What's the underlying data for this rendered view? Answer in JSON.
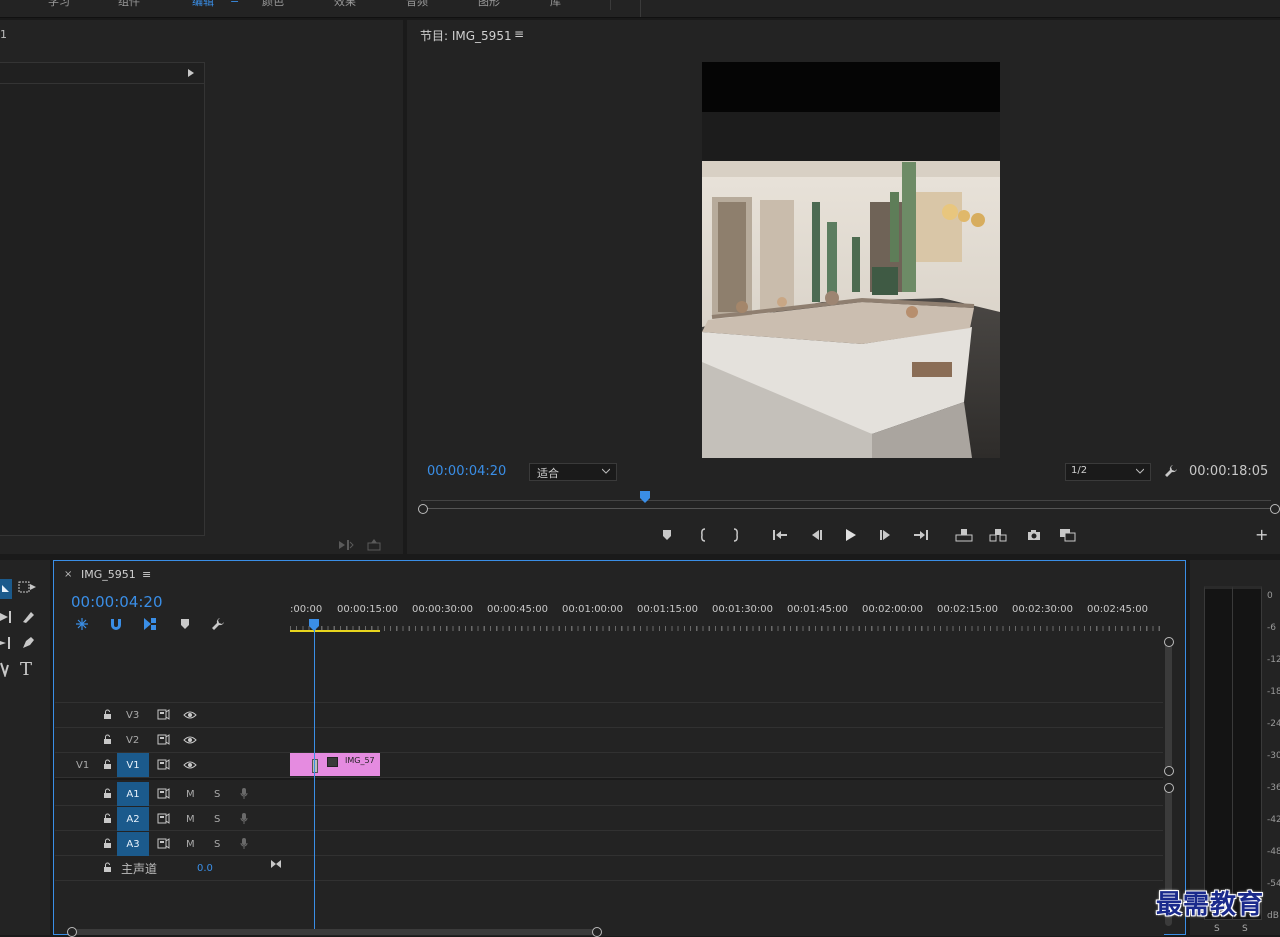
{
  "workspace_tabs": [
    "学习",
    "组件",
    "编辑",
    "颜色",
    "效果",
    "音频",
    "图形",
    "库"
  ],
  "workspace_active_index": 2,
  "source_panel": {
    "title_fragment": "1"
  },
  "program_monitor": {
    "title": "节目: IMG_5951",
    "current_time": "00:00:04:20",
    "zoom_select": "适合",
    "resolution_select": "1/2",
    "duration": "00:00:18:05",
    "playhead_fraction": 0.264
  },
  "timeline": {
    "sequence_name": "IMG_5951",
    "timecode": "00:00:04:20",
    "ruler_labels": [
      ":00:00",
      "00:00:15:00",
      "00:00:30:00",
      "00:00:45:00",
      "00:01:00:00",
      "00:01:15:00",
      "00:01:30:00",
      "00:01:45:00",
      "00:02:00:00",
      "00:02:15:00",
      "00:02:30:00",
      "00:02:45:00"
    ],
    "video_tracks": [
      {
        "name": "V3",
        "source": ""
      },
      {
        "name": "V2",
        "source": ""
      },
      {
        "name": "V1",
        "source": "V1"
      }
    ],
    "audio_tracks": [
      {
        "name": "A1",
        "mute": "M",
        "solo": "S"
      },
      {
        "name": "A2",
        "mute": "M",
        "solo": "S"
      },
      {
        "name": "A3",
        "mute": "M",
        "solo": "S"
      }
    ],
    "master": {
      "label": "主声道",
      "value": "0.0"
    },
    "clip": {
      "label": "IMG_57",
      "color": "#e58be0"
    }
  },
  "audio_meter": {
    "scale": [
      "0",
      "-6",
      "-12",
      "-18",
      "-24",
      "-30",
      "-36",
      "-42",
      "-48",
      "-54",
      "dB"
    ],
    "solo_buttons": [
      "S",
      "S"
    ]
  },
  "watermark": "最需教育",
  "colors": {
    "accent": "#3a8ee6",
    "track_blue": "#1b5a8c",
    "clip_pink": "#e58be0"
  }
}
